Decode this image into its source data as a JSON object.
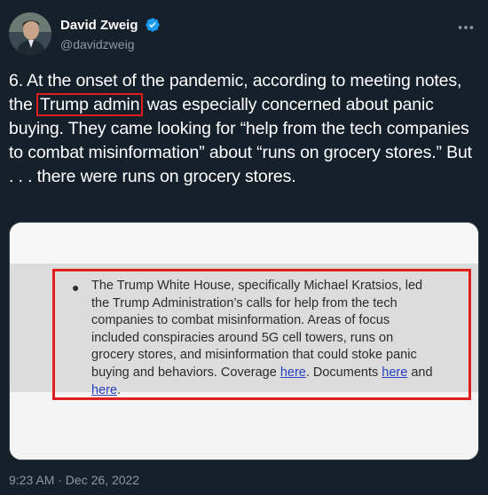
{
  "author": {
    "display_name": "David Zweig",
    "handle": "@davidzweig",
    "avatar_icon": "profile-photo",
    "verified_icon": "verified-badge-icon",
    "verified_color": "#1d9bf0"
  },
  "more_icon": "more-horizontal-icon",
  "tweet": {
    "part1": "6. At the onset of the pandemic, according to meeting notes, the ",
    "highlight": "Trump admin",
    "part2": " was especially concerned about panic buying. They came looking for “help from the tech companies to combat misinformation” about “runs on grocery stores.” ",
    "underlined": "But . . . there were runs on grocery stores",
    "part3": "."
  },
  "media": {
    "doc_text": "The Trump White House, specifically Michael Kratsios, led the Trump Administration’s calls for help from the tech companies to combat misinformation. Areas of focus included conspiracies around 5G cell towers, runs on grocery stores, and misinformation that could stoke panic buying and behaviors. Coverage ",
    "link1": "here",
    "sep1": ". Documents ",
    "link2": "here",
    "sep2": " and ",
    "link3": "here",
    "end": "."
  },
  "timestamp": "9:23 AM · Dec 26, 2022",
  "colors": {
    "background": "#15202b",
    "annotation_red": "#e11d1d",
    "muted_text": "#8b98a5",
    "link_blue": "#2a3fbf"
  }
}
